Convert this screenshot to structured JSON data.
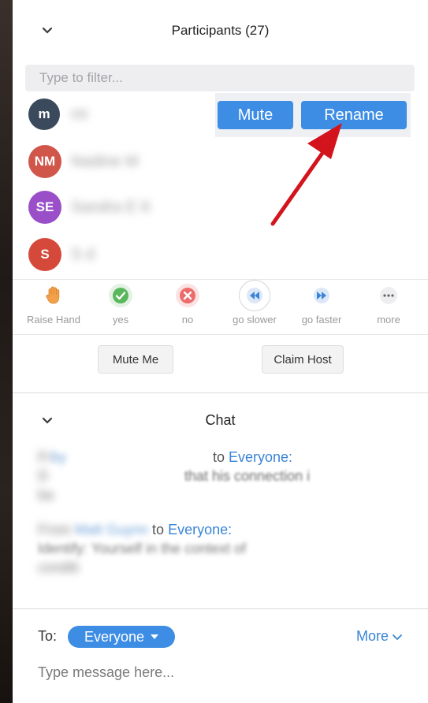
{
  "participants": {
    "title": "Participants (27)",
    "filter_placeholder": "Type to filter...",
    "list": [
      {
        "initials": "m",
        "name": "mi",
        "color": "#3a4a5c"
      },
      {
        "initials": "NM",
        "name": "Nadine M",
        "color": "#d0564a"
      },
      {
        "initials": "SE",
        "name": "Sandra E   K",
        "color": "#9a4fc9"
      },
      {
        "initials": "S",
        "name": "S   d",
        "color": "#d5493a"
      }
    ],
    "hover_actions": {
      "mute": "Mute",
      "rename": "Rename"
    },
    "reactions": [
      {
        "label": "Raise Hand",
        "icon": "raise-hand-icon"
      },
      {
        "label": "yes",
        "icon": "check-icon",
        "color": "#4caf50"
      },
      {
        "label": "no",
        "icon": "x-icon",
        "color": "#e65050"
      },
      {
        "label": "go slower",
        "icon": "rewind-icon",
        "color": "#3a84d8"
      },
      {
        "label": "go faster",
        "icon": "fast-forward-icon",
        "color": "#3a84d8"
      },
      {
        "label": "more",
        "icon": "ellipsis-icon"
      }
    ],
    "buttons": {
      "mute_me": "Mute Me",
      "claim_host": "Claim Host"
    }
  },
  "chat": {
    "title": "Chat",
    "messages": [
      {
        "from_prefix": "Fr",
        "sender": "  by",
        "to_word": " to ",
        "recipient": "Everyone:",
        "line2_blur": "D",
        "line2_clear": "that his connection i",
        "line3": "ba"
      },
      {
        "from_prefix": "From ",
        "sender": "Matt Guynn",
        "to_word": " to ",
        "recipient": "Everyone:",
        "line2_blur": "Identify: Yourself in the context of",
        "line3": "conditi"
      }
    ],
    "to_label": "To:",
    "recipient_pill": "Everyone",
    "more_label": "More",
    "input_placeholder": "Type message here..."
  },
  "colors": {
    "accent": "#3d8de5",
    "annotation_arrow": "#d3141c"
  }
}
